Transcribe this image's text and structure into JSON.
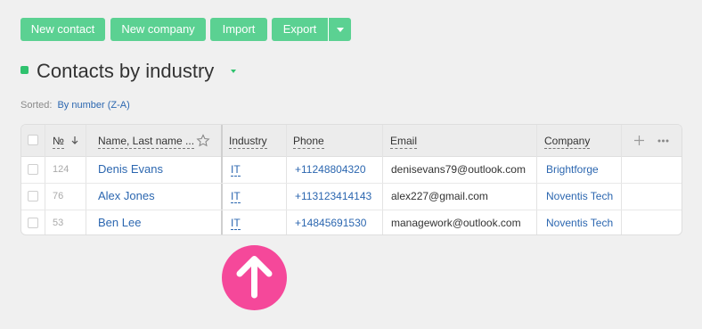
{
  "toolbar": {
    "new_contact": "New contact",
    "new_company": "New company",
    "import": "Import",
    "export": "Export"
  },
  "title": "Contacts by industry",
  "sorted": {
    "label": "Sorted:",
    "value": "By number (Z-A)"
  },
  "columns": {
    "number": "№",
    "name": "Name, Last name ...",
    "industry": "Industry",
    "phone": "Phone",
    "email": "Email",
    "company": "Company"
  },
  "rows": [
    {
      "number": "124",
      "name": "Denis Evans",
      "industry": "IT",
      "phone": "+11248804320",
      "email": "denisevans79@outlook.com",
      "company": "Brightforge"
    },
    {
      "number": "76",
      "name": "Alex Jones",
      "industry": "IT",
      "phone": "+113123414143",
      "email": "alex227@gmail.com",
      "company": "Noventis Tech"
    },
    {
      "number": "53",
      "name": "Ben Lee",
      "industry": "IT",
      "phone": "+14845691530",
      "email": "managework@outlook.com",
      "company": "Noventis Tech"
    }
  ],
  "colors": {
    "button_green": "#5bd192",
    "link_blue": "#2c67b0",
    "fab_pink": "#f5489a"
  },
  "icons": [
    "chevron-down-icon",
    "sort-down-icon",
    "star-icon",
    "plus-icon",
    "more-icon",
    "arrow-up-icon"
  ]
}
